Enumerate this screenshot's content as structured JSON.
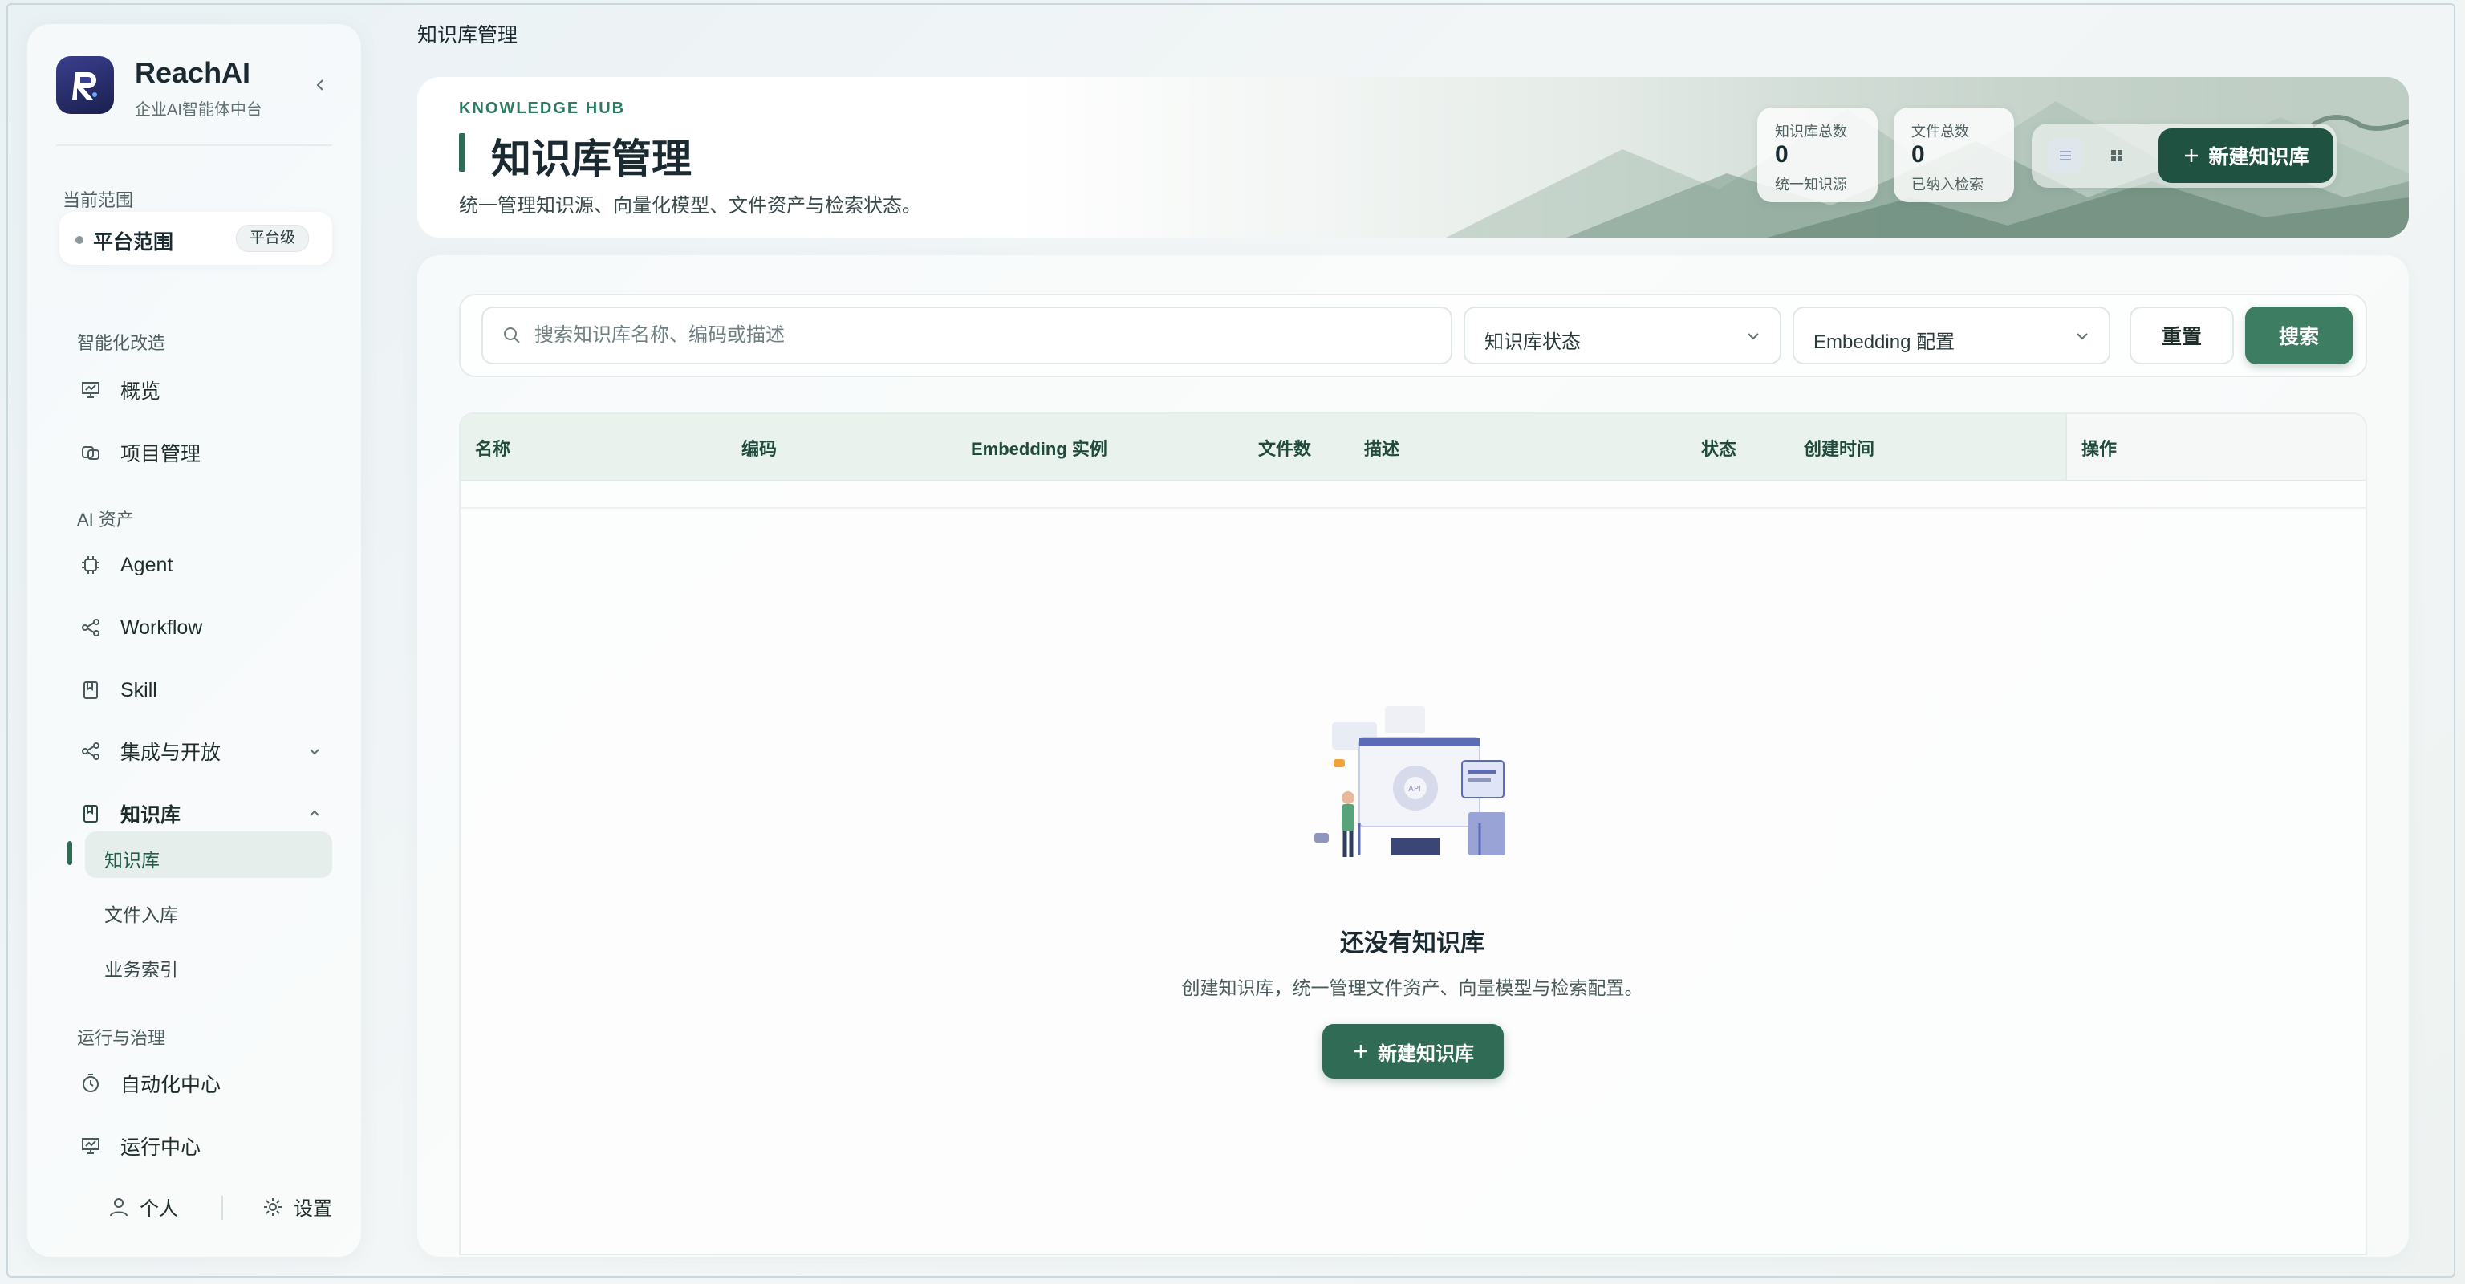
{
  "app": {
    "brand": "ReachAI",
    "brand_sub": "企业AI智能体中台"
  },
  "sidebar": {
    "scope_label": "当前范围",
    "scope_value": "平台范围",
    "scope_badge": "平台级",
    "sections": {
      "s1": "智能化改造",
      "s2": "AI 资产",
      "s3": "运行与治理"
    },
    "items": {
      "overview": "概览",
      "projects": "项目管理",
      "agent": "Agent",
      "workflow": "Workflow",
      "skill": "Skill",
      "integration": "集成与开放",
      "knowledge": "知识库",
      "automation": "自动化中心",
      "runtime": "运行中心"
    },
    "sub_items": {
      "kb": "知识库",
      "ingest": "文件入库",
      "index": "业务索引"
    },
    "footer": {
      "profile": "个人",
      "settings": "设置"
    }
  },
  "page": {
    "breadcrumb": "知识库管理"
  },
  "hero": {
    "eyebrow": "KNOWLEDGE HUB",
    "title": "知识库管理",
    "desc": "统一管理知识源、向量化模型、文件资产与检索状态。",
    "stats": [
      {
        "title": "知识库总数",
        "value": "0",
        "sub": "统一知识源"
      },
      {
        "title": "文件总数",
        "value": "0",
        "sub": "已纳入检索"
      }
    ],
    "create_label": "新建知识库"
  },
  "filters": {
    "search_placeholder": "搜索知识库名称、编码或描述",
    "status_select": "知识库状态",
    "embedding_select": "Embedding 配置",
    "reset_label": "重置",
    "search_label": "搜索"
  },
  "table": {
    "columns": [
      "名称",
      "编码",
      "Embedding 实例",
      "文件数",
      "描述",
      "状态",
      "创建时间",
      "操作"
    ]
  },
  "empty": {
    "title": "还没有知识库",
    "desc": "创建知识库，统一管理文件资产、向量模型与检索配置。",
    "button": "新建知识库"
  },
  "colors": {
    "primary": "#2f6b55",
    "primary_dark": "#1f5240",
    "header_bg": "#eaf2ee"
  }
}
